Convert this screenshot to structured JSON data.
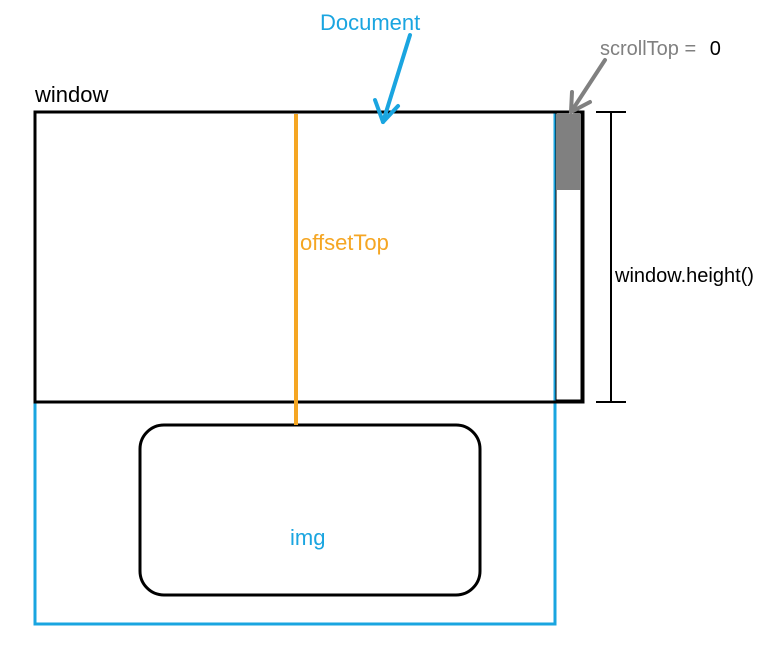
{
  "labels": {
    "document": "Document",
    "window": "window",
    "offsetTop": "offsetTop",
    "img": "img",
    "scrollTop": "scrollTop =",
    "scrollTopValue": "0",
    "windowHeight": "window.height()"
  },
  "colors": {
    "document": "#1aa5e0",
    "offsetTop": "#f5a623",
    "img": "#1aa5e0",
    "scrollbarThumb": "#808080",
    "scrollTopLabel": "#808080",
    "black": "#000000"
  }
}
